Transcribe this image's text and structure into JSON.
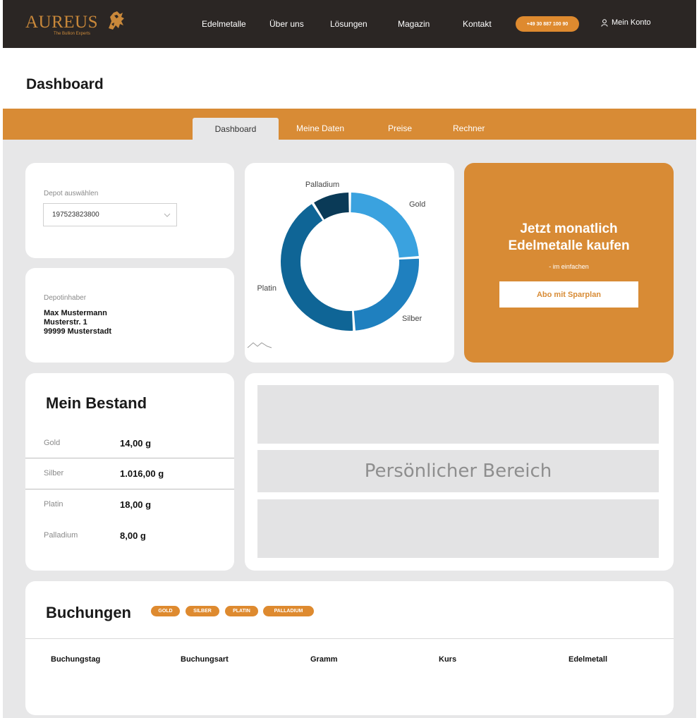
{
  "brand": {
    "name": "AUREUS",
    "tagline": "The Bullion Experts",
    "accent": "#d88b35",
    "dark": "#2b2624"
  },
  "nav": {
    "items": [
      "Edelmetalle",
      "Über uns",
      "Lösungen",
      "Magazin",
      "Kontakt"
    ],
    "phone": "+49 30 887 100 90",
    "account": "Mein Konto"
  },
  "page": {
    "title": "Dashboard"
  },
  "tabs": {
    "active": "Dashboard",
    "items": [
      "Meine Daten",
      "Preise",
      "Rechner"
    ]
  },
  "depot": {
    "label": "Depot auswählen",
    "selected": "197523823800"
  },
  "holder": {
    "label": "Depotinhaber",
    "name": "Max Mustermann",
    "street": "Musterstr. 1",
    "city": "99999 Musterstadt"
  },
  "chart_data": {
    "type": "pie",
    "donut": true,
    "categories": [
      "Gold",
      "Silber",
      "Platin",
      "Palladium"
    ],
    "values": [
      24,
      25,
      42,
      9
    ],
    "colors": [
      "#3aa2df",
      "#1f80bf",
      "#0f6596",
      "#0a3a57"
    ]
  },
  "promo": {
    "title_line1": "Jetzt monatlich",
    "title_line2": "Edelmetalle kaufen",
    "subtitle": "- im einfachen",
    "button": "Abo mit Sparplan"
  },
  "bestand": {
    "title": "Mein Bestand",
    "rows": [
      {
        "metal": "Gold",
        "amount": "14,00 g"
      },
      {
        "metal": "Silber",
        "amount": "1.016,00 g"
      },
      {
        "metal": "Platin",
        "amount": "18,00 g"
      },
      {
        "metal": "Palladium",
        "amount": "8,00 g"
      }
    ]
  },
  "personal": {
    "text": "Persönlicher Bereich"
  },
  "buchungen": {
    "title": "Buchungen",
    "filters": [
      "GOLD",
      "SILBER",
      "PLATIN",
      "PALLADIUM"
    ],
    "columns": [
      "Buchungstag",
      "Buchungsart",
      "Gramm",
      "Kurs",
      "Edelmetall"
    ]
  }
}
